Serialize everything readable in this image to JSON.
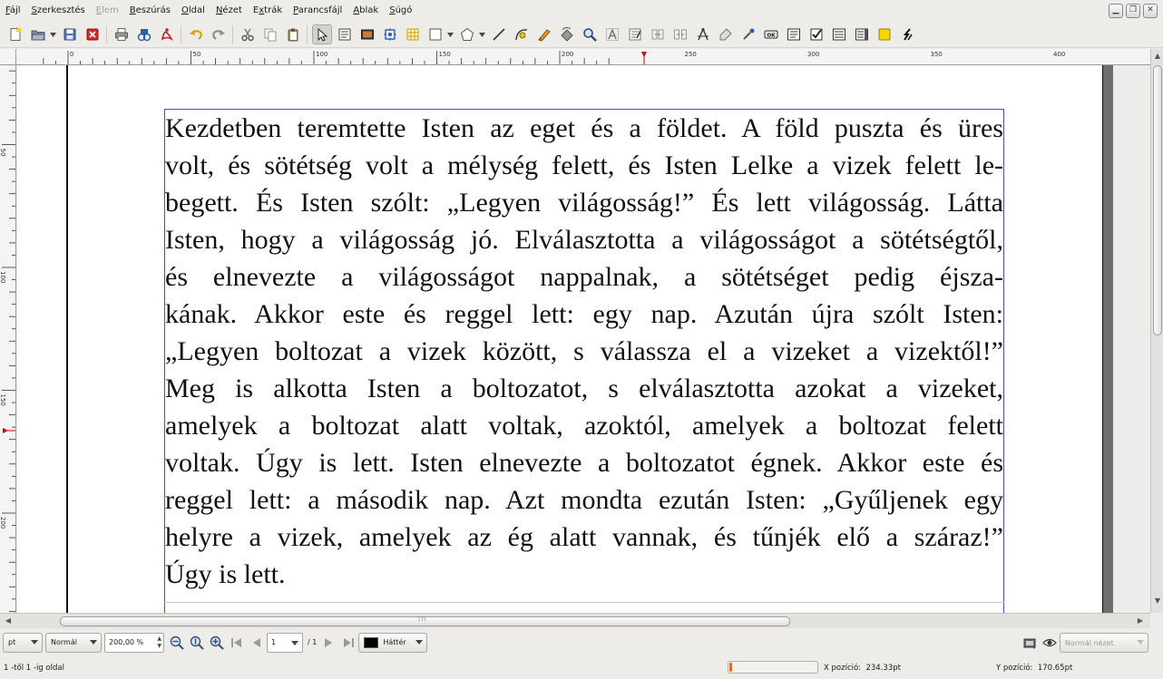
{
  "menu": {
    "items": [
      {
        "pre": "",
        "ul": "F",
        "post": "ájl",
        "disabled": false
      },
      {
        "pre": "",
        "ul": "S",
        "post": "zerkesztés",
        "disabled": false
      },
      {
        "pre": "",
        "ul": "E",
        "post": "lem",
        "disabled": true
      },
      {
        "pre": "",
        "ul": "B",
        "post": "eszúrás",
        "disabled": false
      },
      {
        "pre": "",
        "ul": "O",
        "post": "ldal",
        "disabled": false
      },
      {
        "pre": "",
        "ul": "N",
        "post": "ézet",
        "disabled": false
      },
      {
        "pre": "E",
        "ul": "x",
        "post": "trák",
        "disabled": false
      },
      {
        "pre": "",
        "ul": "P",
        "post": "arancsfájl",
        "disabled": false
      },
      {
        "pre": "",
        "ul": "A",
        "post": "blak",
        "disabled": false
      },
      {
        "pre": "",
        "ul": "S",
        "post": "úgó",
        "disabled": false
      }
    ]
  },
  "toolbar": {
    "icons": [
      "new-document-icon",
      "open-document-icon",
      "save-icon",
      "close-document-icon",
      "print-icon",
      "preflight-verifier-icon",
      "export-pdf-icon",
      "undo-icon",
      "redo-icon",
      "cut-icon",
      "copy-icon",
      "paste-icon",
      "select-item-icon",
      "text-frame-icon",
      "image-frame-icon",
      "render-frame-icon",
      "table-icon",
      "shape-icon",
      "polygon-icon",
      "line-icon",
      "bezier-curve-icon",
      "freehand-line-icon",
      "rotate-item-icon",
      "zoom-icon",
      "edit-contents-icon",
      "edit-text-icon",
      "link-frames-icon",
      "unlink-frames-icon",
      "measurements-icon",
      "copy-properties-icon",
      "eyedropper-icon",
      "pdf-push-button-icon",
      "pdf-text-field-icon",
      "pdf-checkbox-icon",
      "pdf-combo-box-icon",
      "pdf-list-box-icon",
      "text-annotation-icon",
      "link-annotation-icon"
    ]
  },
  "rulers": {
    "horizontal_labels": [
      "0",
      "50",
      "100",
      "150",
      "200",
      "250",
      "300",
      "350",
      "400"
    ],
    "vertical_labels": [
      "50",
      "100",
      "150",
      "200"
    ]
  },
  "document": {
    "text": "Kezdetben teremtette Isten az eget és a földet. A föld puszta és üres volt, és sötétség volt a mélység felett, és Isten Lelke a vizek felett lebegett. És Isten szólt: „Legyen világosság!” És lett világosság. Látta Isten, hogy a világosság jó. Elválasztotta a világosságot a sötétségtől, és elnevezte a világosságot nappalnak, a sötétséget pedig éjszakának. Akkor este és reggel lett: egy nap. Azután újra szólt Isten: „Legyen boltozat a vizek között, s válassza el a vizeket a vizektől!” Meg is alkotta Isten a boltozatot, s elválasztotta azokat a vizeket, amelyek a boltozat alatt voltak, azoktól, amelyek a boltozat felett voltak. Úgy is lett. Isten elnevezte a boltozatot égnek. Akkor este és reggel lett: a második nap. Azt mondta ezután Isten: „Gyűljenek egy helyre a vizek, amelyek az ég alatt vannak, és tűnjék elő a száraz!” Úgy is lett.",
    "lines": [
      "Kezdetben teremtette Isten az eget és a földet. A föld puszta és üres",
      "volt, és sötétség volt a mélység felett, és Isten Lelke a vizek felett le-",
      "begett. És Isten szólt: „Legyen világosság!” És lett világosság. Látta",
      "Isten, hogy a világosság jó. Elválasztotta a világosságot a sötétségtől,",
      "és elnevezte a világosságot nappalnak, a sötétséget pedig éjsza-",
      "kának. Akkor este és reggel lett: egy nap. Azután újra szólt Isten:",
      "„Legyen boltozat a vizek között, s válassza el a vizeket a vizektől!”",
      "Meg is alkotta Isten a boltozatot, s elválasztotta azokat a vizeket,",
      "amelyek a boltozat alatt voltak, azoktól, amelyek a boltozat felett",
      "voltak. Úgy is lett. Isten elnevezte a boltozatot égnek. Akkor este és",
      "reggel lett: a második nap. Azt mondta ezután Isten: „Gyűljenek egy",
      "helyre a vizek, amelyek az ég alatt vannak, és tűnjék elő a száraz!”",
      "Úgy is lett."
    ]
  },
  "bottombar": {
    "unit": "pt",
    "image_preview_quality": "Normál",
    "zoom": "200,00 %",
    "page_number": "1",
    "page_total": "/ 1",
    "layer": "Háttér",
    "layer_color": "#000000",
    "view_mode": "Normál nézet"
  },
  "status": {
    "page_info": "1 -től 1 -ig oldal",
    "progress": 0.03,
    "x_label": "X pozíció:",
    "x_value": "234.33pt",
    "y_label": "Y pozíció:",
    "y_value": "170.65pt"
  },
  "colors": {
    "frame_border": "#4a4ad0",
    "progress_fill": "#e86d1c",
    "ruler_marker": "#cc0000"
  }
}
